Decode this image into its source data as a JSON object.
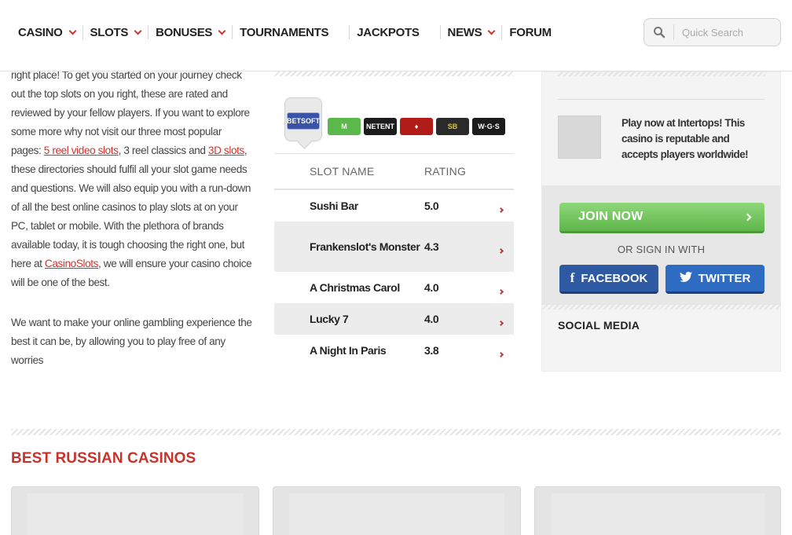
{
  "nav": {
    "items": [
      {
        "label": "CASINO",
        "dropdown": true
      },
      {
        "label": "SLOTS",
        "dropdown": true
      },
      {
        "label": "BONUSES",
        "dropdown": true
      },
      {
        "label": "TOURNAMENTS",
        "dropdown": false
      },
      {
        "label": "JACKPOTS",
        "dropdown": false
      },
      {
        "label": "NEWS",
        "dropdown": true
      },
      {
        "label": "FORUM",
        "dropdown": false
      }
    ]
  },
  "search": {
    "placeholder": "Quick Search",
    "icon": "search-icon"
  },
  "intro": {
    "p1_a": "right place! To get you started on your journey check out the top slots on you right, these are rated and reviewed by your fellow players. If you want to explore some more why not visit our three most popular pages: ",
    "link_5reel": "5 reel video slots",
    "p1_b": ", 3 reel classics and ",
    "link_3d": "3D slots",
    "p1_c": ", these directories should fulfil all your slot game needs and questions. We will also equip you with a run-down of all the best online casinos to play slots at on your PC, tablet or mobile. With the plethora of brands available today, it is tough choosing the right one, but here at ",
    "link_casinoslots": "CasinoSlots",
    "p1_d": ", we will ensure your casino choice will be one of the best.",
    "p2": "We want to make your online gambling experience the best it can be, by allowing you to play free of any worries"
  },
  "providers": [
    {
      "name": "BETSOFT",
      "active": true
    },
    {
      "name": "M",
      "active": false
    },
    {
      "name": "NETENT",
      "active": false
    },
    {
      "name": "♦",
      "active": false
    },
    {
      "name": "SB",
      "active": false
    },
    {
      "name": "W·G·S",
      "active": false
    }
  ],
  "slots": {
    "headers": {
      "name": "SLOT NAME",
      "rating": "RATING"
    },
    "rows": [
      {
        "name": "Sushi Bar",
        "rating": "5.0"
      },
      {
        "name": "Frankenslot's Monster",
        "rating": "4.3"
      },
      {
        "name": "A Christmas Carol",
        "rating": "4.0"
      },
      {
        "name": "Lucky 7",
        "rating": "4.0"
      },
      {
        "name": "A Night In Paris",
        "rating": "3.8"
      }
    ]
  },
  "sidebar": {
    "promo_text": "Play now at Intertops! This casino is reputable and accepts players worldwide!",
    "join_label": "JOIN NOW",
    "or_sign_in": "OR SIGN IN WITH",
    "facebook_label": "FACEBOOK",
    "twitter_label": "TWITTER",
    "social_media_heading": "SOCIAL MEDIA"
  },
  "bottom": {
    "title": "BEST RUSSIAN CASINOS"
  },
  "colors": {
    "accent": "#d0322c",
    "green": "#5fb64a",
    "facebook": "#2e5aa3",
    "twitter": "#2e6cc4"
  }
}
